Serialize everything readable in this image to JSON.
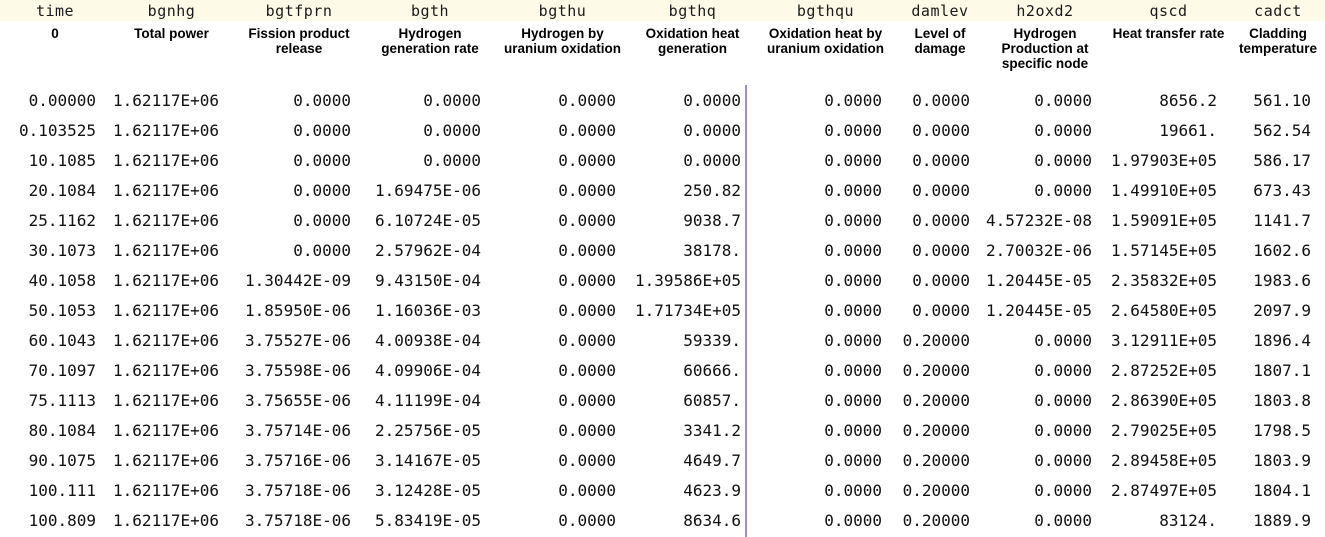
{
  "table": {
    "variable_names": [
      "time",
      "bgnhg",
      "bgtfprn",
      "bgth",
      "bgthu",
      "bgthq",
      "bgthqu",
      "damlev",
      "h2oxd2",
      "qscd",
      "cadct"
    ],
    "descriptions": [
      "0",
      "Total power",
      "Fission product release",
      "Hydrogen generation rate",
      "Hydrogen by uranium oxidation",
      "Oxidation heat generation",
      "Oxidation heat by uranium oxidation",
      "Level of damage",
      "Hydrogen Production at specific node",
      "Heat transfer rate",
      "Cladding temperature"
    ],
    "rows": [
      [
        "0.00000",
        "1.62117E+06",
        "0.0000",
        "0.0000",
        "0.0000",
        "0.0000",
        "0.0000",
        "0.0000",
        "0.0000",
        "8656.2",
        "561.10"
      ],
      [
        "0.103525",
        "1.62117E+06",
        "0.0000",
        "0.0000",
        "0.0000",
        "0.0000",
        "0.0000",
        "0.0000",
        "0.0000",
        "19661.",
        "562.54"
      ],
      [
        "10.1085",
        "1.62117E+06",
        "0.0000",
        "0.0000",
        "0.0000",
        "0.0000",
        "0.0000",
        "0.0000",
        "0.0000",
        "1.97903E+05",
        "586.17"
      ],
      [
        "20.1084",
        "1.62117E+06",
        "0.0000",
        "1.69475E-06",
        "0.0000",
        "250.82",
        "0.0000",
        "0.0000",
        "0.0000",
        "1.49910E+05",
        "673.43"
      ],
      [
        "25.1162",
        "1.62117E+06",
        "0.0000",
        "6.10724E-05",
        "0.0000",
        "9038.7",
        "0.0000",
        "0.0000",
        "4.57232E-08",
        "1.59091E+05",
        "1141.7"
      ],
      [
        "30.1073",
        "1.62117E+06",
        "0.0000",
        "2.57962E-04",
        "0.0000",
        "38178.",
        "0.0000",
        "0.0000",
        "2.70032E-06",
        "1.57145E+05",
        "1602.6"
      ],
      [
        "40.1058",
        "1.62117E+06",
        "1.30442E-09",
        "9.43150E-04",
        "0.0000",
        "1.39586E+05",
        "0.0000",
        "0.0000",
        "1.20445E-05",
        "2.35832E+05",
        "1983.6"
      ],
      [
        "50.1053",
        "1.62117E+06",
        "1.85950E-06",
        "1.16036E-03",
        "0.0000",
        "1.71734E+05",
        "0.0000",
        "0.0000",
        "1.20445E-05",
        "2.64580E+05",
        "2097.9"
      ],
      [
        "60.1043",
        "1.62117E+06",
        "3.75527E-06",
        "4.00938E-04",
        "0.0000",
        "59339.",
        "0.0000",
        "0.20000",
        "0.0000",
        "3.12911E+05",
        "1896.4"
      ],
      [
        "70.1097",
        "1.62117E+06",
        "3.75598E-06",
        "4.09906E-04",
        "0.0000",
        "60666.",
        "0.0000",
        "0.20000",
        "0.0000",
        "2.87252E+05",
        "1807.1"
      ],
      [
        "75.1113",
        "1.62117E+06",
        "3.75655E-06",
        "4.11199E-04",
        "0.0000",
        "60857.",
        "0.0000",
        "0.20000",
        "0.0000",
        "2.86390E+05",
        "1803.8"
      ],
      [
        "80.1084",
        "1.62117E+06",
        "3.75714E-06",
        "2.25756E-05",
        "0.0000",
        "3341.2",
        "0.0000",
        "0.20000",
        "0.0000",
        "2.79025E+05",
        "1798.5"
      ],
      [
        "90.1075",
        "1.62117E+06",
        "3.75716E-06",
        "3.14167E-05",
        "0.0000",
        "4649.7",
        "0.0000",
        "0.20000",
        "0.0000",
        "2.89458E+05",
        "1803.9"
      ],
      [
        "100.111",
        "1.62117E+06",
        "3.75718E-06",
        "3.12428E-05",
        "0.0000",
        "4623.9",
        "0.0000",
        "0.20000",
        "0.0000",
        "2.87497E+05",
        "1804.1"
      ],
      [
        "100.809",
        "1.62117E+06",
        "3.75718E-06",
        "5.83419E-05",
        "0.0000",
        "8634.6",
        "0.0000",
        "0.20000",
        "0.0000",
        "83124.",
        "1889.9"
      ]
    ]
  },
  "colors": {
    "header_band_background": "#fdfbe8",
    "split_line": "#9a8fd0",
    "text": "#111111",
    "background": "#ffffff"
  }
}
